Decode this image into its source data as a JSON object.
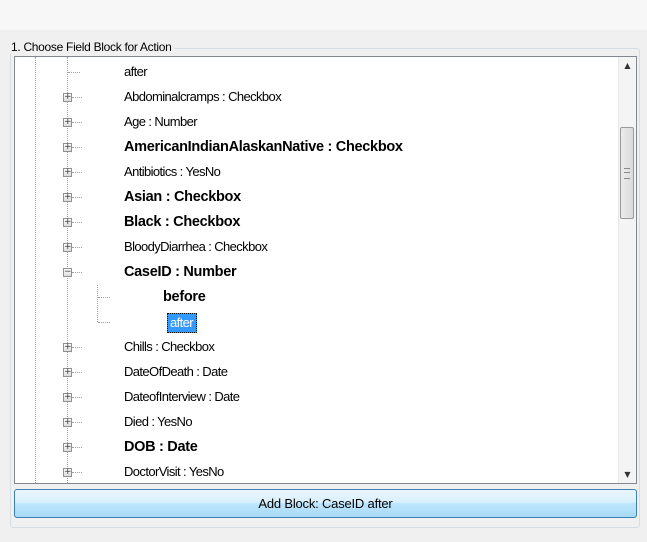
{
  "group": {
    "title": "1. Choose Field Block for Action"
  },
  "tree": {
    "nodes": [
      {
        "label": "after",
        "level": 1,
        "bold": false,
        "expander": "none",
        "selected": false
      },
      {
        "label": "Abdominalcramps : Checkbox",
        "level": 0,
        "bold": false,
        "expander": "plus",
        "selected": false
      },
      {
        "label": "Age : Number",
        "level": 0,
        "bold": false,
        "expander": "plus",
        "selected": false
      },
      {
        "label": "AmericanIndianAlaskanNative : Checkbox",
        "level": 0,
        "bold": true,
        "expander": "plus",
        "selected": false
      },
      {
        "label": "Antibiotics : YesNo",
        "level": 0,
        "bold": false,
        "expander": "plus",
        "selected": false
      },
      {
        "label": "Asian : Checkbox",
        "level": 0,
        "bold": true,
        "expander": "plus",
        "selected": false
      },
      {
        "label": "Black : Checkbox",
        "level": 0,
        "bold": true,
        "expander": "plus",
        "selected": false
      },
      {
        "label": "BloodyDiarrhea : Checkbox",
        "level": 0,
        "bold": false,
        "expander": "plus",
        "selected": false
      },
      {
        "label": "CaseID : Number",
        "level": 0,
        "bold": true,
        "expander": "minus",
        "selected": false
      },
      {
        "label": "before",
        "level": 1,
        "bold": true,
        "expander": "none",
        "selected": false
      },
      {
        "label": "after",
        "level": 1,
        "bold": false,
        "expander": "none",
        "selected": true
      },
      {
        "label": "Chills : Checkbox",
        "level": 0,
        "bold": false,
        "expander": "plus",
        "selected": false
      },
      {
        "label": "DateOfDeath : Date",
        "level": 0,
        "bold": false,
        "expander": "plus",
        "selected": false
      },
      {
        "label": "DateofInterview : Date",
        "level": 0,
        "bold": false,
        "expander": "plus",
        "selected": false
      },
      {
        "label": "Died : YesNo",
        "level": 0,
        "bold": false,
        "expander": "plus",
        "selected": false
      },
      {
        "label": "DOB : Date",
        "level": 0,
        "bold": true,
        "expander": "plus",
        "selected": false
      },
      {
        "label": "DoctorVisit : YesNo",
        "level": 0,
        "bold": false,
        "expander": "plus",
        "selected": false
      }
    ],
    "scrollbar": {
      "up_glyph": "▲",
      "down_glyph": "▼"
    }
  },
  "add_button": {
    "label": "Add Block: CaseID after"
  },
  "colors": {
    "selection": "#3399ff",
    "button_border": "#3c7fb1"
  }
}
